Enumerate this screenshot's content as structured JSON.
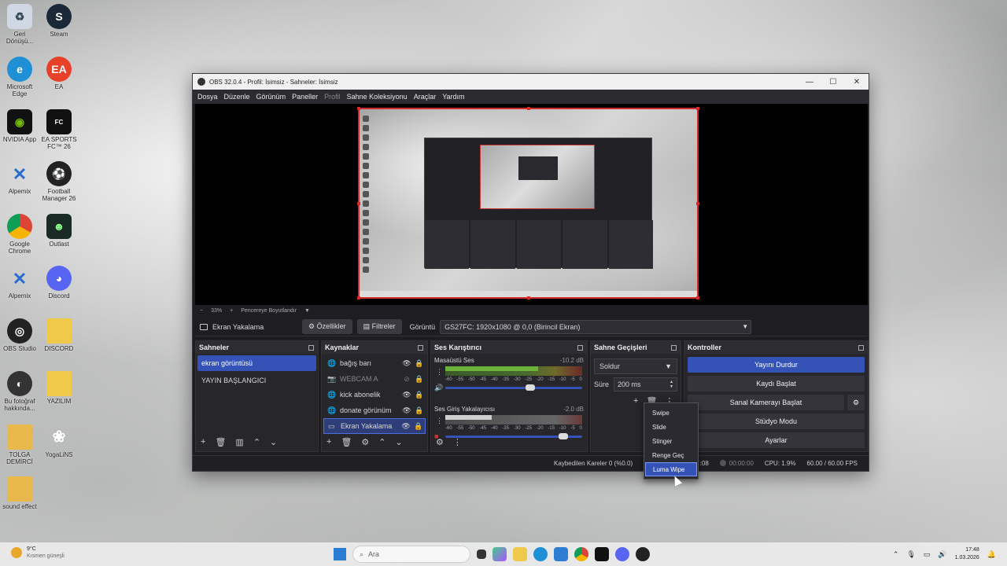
{
  "desktop": {
    "icons": [
      {
        "label": "Geri Dönüşü..."
      },
      {
        "label": "Steam"
      },
      {
        "label": "Microsoft Edge"
      },
      {
        "label": "EA"
      },
      {
        "label": "NVIDIA App"
      },
      {
        "label": "EA SPORTS FC™ 26"
      },
      {
        "label": "Alpemix"
      },
      {
        "label": "Football Manager 26"
      },
      {
        "label": "Google Chrome"
      },
      {
        "label": "Outlast"
      },
      {
        "label": "Alpemix"
      },
      {
        "label": "Discord"
      },
      {
        "label": "OBS Studio"
      },
      {
        "label": "DISCORD"
      },
      {
        "label": "Bu fotoğraf hakkında..."
      },
      {
        "label": "YAZILIM"
      },
      {
        "label": "TOLGA DEMİRCİ"
      },
      {
        "label": "YogaLiNS"
      },
      {
        "label": "sound effect"
      }
    ]
  },
  "window": {
    "title": "OBS 32.0.4 - Profil: İsimsiz - Sahneler: İsimsiz",
    "minimize": "—",
    "maximize": "☐",
    "close": "✕"
  },
  "menu": [
    "Dosya",
    "Düzenle",
    "Görünüm",
    "Paneller",
    "Profil",
    "Sahne Koleksiyonu",
    "Araçlar",
    "Yardım"
  ],
  "zoom": {
    "minus": "−",
    "value": "33%",
    "plus": "+",
    "fit": "Pencereye Boyutlandır",
    "caret": "▼"
  },
  "source_toolbar": {
    "source_name": "Ekran Yakalama",
    "properties": "Özellikler",
    "filters": "Filtreler",
    "display_label": "Görüntü",
    "display_value": "GS27FC: 1920x1080 @ 0,0 (Birincil Ekran)",
    "caret": "▼"
  },
  "scenes": {
    "title": "Sahneler",
    "items": [
      "ekran görüntüsü",
      "YAYIN BAŞLANGICI"
    ]
  },
  "sources": {
    "title": "Kaynaklar",
    "items": [
      {
        "name": "bağış barı"
      },
      {
        "name": "WEBCAM A"
      },
      {
        "name": "kick abonelik"
      },
      {
        "name": "donate görünüm"
      },
      {
        "name": "Ekran Yakalama"
      }
    ]
  },
  "mixer": {
    "title": "Ses Karıştırıcı",
    "channels": [
      {
        "name": "Masaüstü Ses",
        "db": "-10.2 dB",
        "level": 0.68,
        "volume": 0.62
      },
      {
        "name": "Ses Giriş Yakalayıcısı",
        "db": "-2.0 dB",
        "level": 0.34,
        "volume": 0.86
      }
    ],
    "ticks": [
      "-60",
      "-55",
      "-50",
      "-45",
      "-40",
      "-35",
      "-30",
      "-25",
      "-20",
      "-15",
      "-10",
      "-5",
      "0"
    ]
  },
  "transitions": {
    "title": "Sahne Geçişleri",
    "selected": "Soldur",
    "duration_label": "Süre",
    "duration_value": "200 ms",
    "caret": "▼",
    "up": "▲",
    "down": "▼"
  },
  "controls": {
    "title": "Kontroller",
    "stop_stream": "Yayını Durdur",
    "start_record": "Kaydı Başlat",
    "virtual_cam": "Sanal Kamerayı Başlat",
    "studio_mode": "Stüdyo Modu",
    "settings": "Ayarlar"
  },
  "status": {
    "dropped": "Kaybedilen Kareler 0 (%0.0)",
    "bitrate_partial": "79",
    "stream_time_partial": ":08",
    "rec_time": "00:00:00",
    "cpu": "CPU: 1.9%",
    "fps": "60.00 / 60.00 FPS"
  },
  "dropdown": {
    "options": [
      "Swipe",
      "Slide",
      "Stinger",
      "Renge Geç",
      "Luma Wipe"
    ],
    "selected_index": 4
  },
  "taskbar": {
    "temp": "9°C",
    "weather": "Kısmen güneşli",
    "search_placeholder": "Ara",
    "time": "17:48",
    "date": "1.03.2026"
  },
  "colors": {
    "accent": "#3553b6",
    "selection_border": "#d42a2a"
  }
}
